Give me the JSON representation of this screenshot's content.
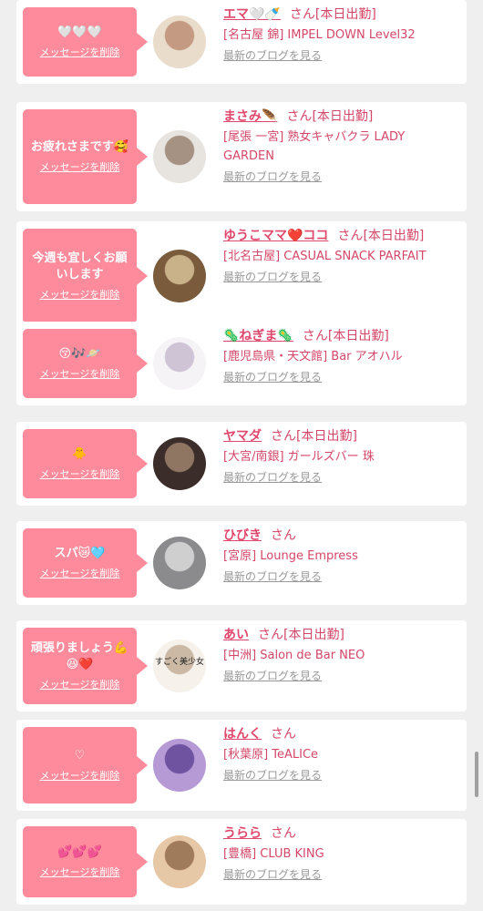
{
  "delete_label": "メッセージを削除",
  "blog_label": "最新のブログを見る",
  "san_label": "さん",
  "items": [
    {
      "message": "🤍🤍🤍",
      "name": "エマ🤍🍼",
      "status": "[本日出勤]",
      "shop": "[名古屋 錦] IMPEL DOWN Level32"
    },
    {
      "message": "お疲れさまです🥰",
      "name": "まさみ🪶",
      "status": "[本日出勤]",
      "shop": "[尾張 一宮] 熟女キャバクラ LADY GARDEN"
    },
    {
      "message": "今週も宜しくお願いします",
      "name": "ゆうこママ❤️ココ",
      "status": "[本日出勤]",
      "shop": "[北名古屋] CASUAL SNACK PARFAIT"
    },
    {
      "message": "😚🎶🪐",
      "name": "🦠ねぎま🦠",
      "status": "[本日出勤]",
      "shop": "[鹿児島県・天文館] Bar アオハル"
    },
    {
      "message": "🐥",
      "name": "ヤマダ",
      "status": "[本日出勤]",
      "shop": "[大宮/南銀] ガールズバー 珠"
    },
    {
      "message": "スパ😿🩵",
      "name": "ひびき",
      "status": "",
      "shop": "[宮原] Lounge Empress"
    },
    {
      "message": "頑張りましょう💪😆❤️",
      "name": "あい",
      "status": "[本日出勤]",
      "shop": "[中洲] Salon de Bar NEO",
      "avatar_text": "すごく美少女"
    },
    {
      "message": "♡",
      "name": "はんく",
      "status": "",
      "shop": "[秋葉原] TeALICe"
    },
    {
      "message": "💕💕💕",
      "name": "うらら",
      "status": "",
      "shop": "[豊橋] CLUB KING"
    }
  ],
  "colors": {
    "bubble": "#fd8b9b",
    "accent": "#e0476c",
    "link_gray": "#999999",
    "background": "#efefef"
  }
}
